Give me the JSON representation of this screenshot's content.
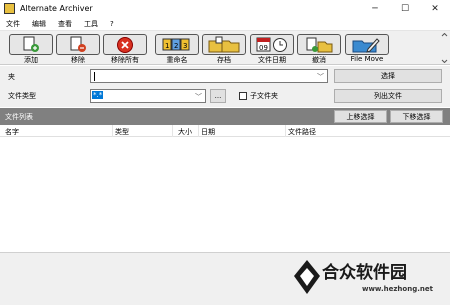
{
  "window": {
    "title": "Alternate Archiver"
  },
  "menu": [
    "文件",
    "编辑",
    "查看",
    "工具",
    "?"
  ],
  "toolbar": [
    {
      "label": "添加",
      "icon": "add-doc-icon"
    },
    {
      "label": "移除",
      "icon": "remove-doc-icon"
    },
    {
      "label": "移除所有",
      "icon": "remove-all-icon"
    },
    {
      "label": "重命名",
      "icon": "rename-icon"
    },
    {
      "label": "存档",
      "icon": "archive-icon"
    },
    {
      "label": "文件日期",
      "icon": "file-date-icon"
    },
    {
      "label": "撤消",
      "icon": "undo-icon"
    },
    {
      "label": "File Move",
      "icon": "file-move-icon"
    }
  ],
  "form": {
    "folder_label": "夹",
    "folder_value": "",
    "select_button": "选择",
    "filetype_label": "文件类型",
    "filetype_value": "*.*",
    "browse_button": "...",
    "subfolder_label": "子文件夹",
    "list_button": "列出文件"
  },
  "filelist": {
    "title": "文件列表",
    "move_up": "上移选择",
    "move_down": "下移选择",
    "columns": [
      "名字",
      "类型",
      "大小",
      "日期",
      "文件路径"
    ]
  },
  "watermark": {
    "text": "合众软件园",
    "url": "www.hezhong.net"
  }
}
